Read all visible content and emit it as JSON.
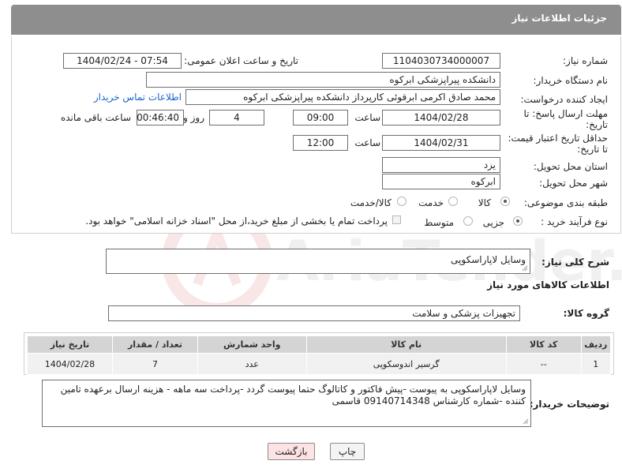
{
  "header": {
    "title": "جزئیات اطلاعات نیاز"
  },
  "form": {
    "need_number_label": "شماره نیاز:",
    "need_number": "1104030734000007",
    "announce_label": "تاریخ و ساعت اعلان عمومی:",
    "announce_value": "1404/02/24 - 07:54",
    "buyer_org_label": "نام دستگاه خریدار:",
    "buyer_org": "دانشکده پیراپزشکی ابرکوه",
    "creator_label": "ایجاد کننده درخواست:",
    "creator": "محمد صادق اکرمی ابرقوئی کارپرداز دانشکده پیراپزشکی ابرکوه",
    "contact_link": "اطلاعات تماس خریدار",
    "deadline_label_1": "مهلت ارسال پاسخ: تا",
    "deadline_label_2": "تاریخ:",
    "deadline_date": "1404/02/28",
    "time_label": "ساعت",
    "deadline_time": "09:00",
    "days": "4",
    "days_label": "روز و",
    "remaining_time": "00:46:40",
    "remaining_label": "ساعت باقی مانده",
    "validity_label_1": "حداقل تاریخ اعتبار قیمت:",
    "validity_label_2": "تا تاریخ:",
    "validity_date": "1404/02/31",
    "validity_time": "12:00",
    "province_label": "استان محل تحویل:",
    "province": "یزد",
    "city_label": "شهر محل تحویل:",
    "city": "ابرکوه",
    "category_label": "طبقه بندی موضوعی:",
    "category_options": [
      "کالا",
      "خدمت",
      "کالا/خدمت"
    ],
    "process_label": "نوع فرآیند خرید :",
    "process_options": [
      "جزیی",
      "متوسط"
    ],
    "payment_note": "پرداخت تمام یا بخشی از مبلغ خرید،از محل \"اسناد خزانه اسلامی\" خواهد بود."
  },
  "summary": {
    "label": "شرح کلی نیاز:",
    "value": "وسایل لاپاراسکوپی"
  },
  "goods": {
    "section_title": "اطلاعات کالاهای مورد نیاز",
    "group_label": "گروه کالا:",
    "group_value": "تجهیزات پزشکی و سلامت",
    "columns": [
      "ردیف",
      "کد کالا",
      "نام کالا",
      "واحد شمارش",
      "تعداد / مقدار",
      "تاریخ نیاز"
    ],
    "rows": [
      [
        "1",
        "--",
        "گرسیر اندوسکوپی",
        "عدد",
        "7",
        "1404/02/28"
      ]
    ]
  },
  "buyer_notes": {
    "label": "توضیحات خریدار:",
    "value": "وسایل لاپاراسکوپی به پیوست -پیش فاکتور و کاتالوگ حتما پیوست گردد -پرداخت سه ماهه - هزینه ارسال برعهده تامین کننده -شماره کارشناس 09140714348 قاسمی"
  },
  "buttons": {
    "print": "چاپ",
    "back": "بازگشت"
  },
  "watermark": {
    "text": "AriaTender.neT"
  },
  "colors": {
    "header_bg": "#8e8e8e",
    "link": "#1a66c6",
    "back_button_bg": "#fde3e3",
    "table_header_bg": "#d4d4d4"
  }
}
